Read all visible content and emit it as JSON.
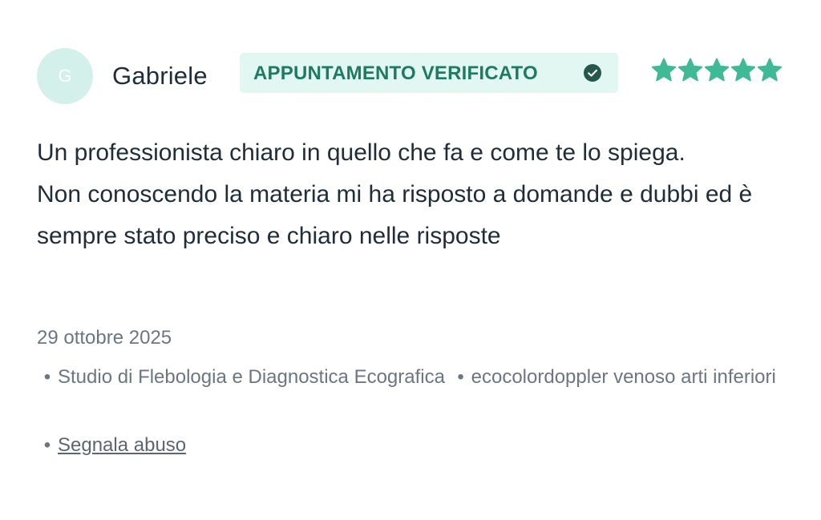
{
  "review": {
    "avatar_initial": "G",
    "author": "Gabriele",
    "badge_label": "APPUNTAMENTO VERIFICATO",
    "rating": 5,
    "rating_max": 5,
    "text_line1": "Un professionista chiaro in quello che fa e come te lo spiega.",
    "text_line2": "Non conoscendo la materia mi ha risposto a domande e dubbi ed è sempre stato preciso e chiaro nelle risposte",
    "date": "29 ottobre 2025",
    "bullet": "•",
    "clinic": "Studio di Flebologia e Diagnostica Ecografica",
    "service": "ecocolordoppler venoso arti inferiori",
    "report_label": "Segnala abuso"
  },
  "colors": {
    "accent": "#3fb996",
    "badge_bg": "#e2f6f2",
    "badge_text": "#1f7a63",
    "avatar_bg": "#d3f1ea",
    "text_primary": "#1f2d3a",
    "text_secondary": "#6b7684"
  },
  "icons": {
    "badge": "check-circle-icon",
    "rating": "star-icon"
  }
}
